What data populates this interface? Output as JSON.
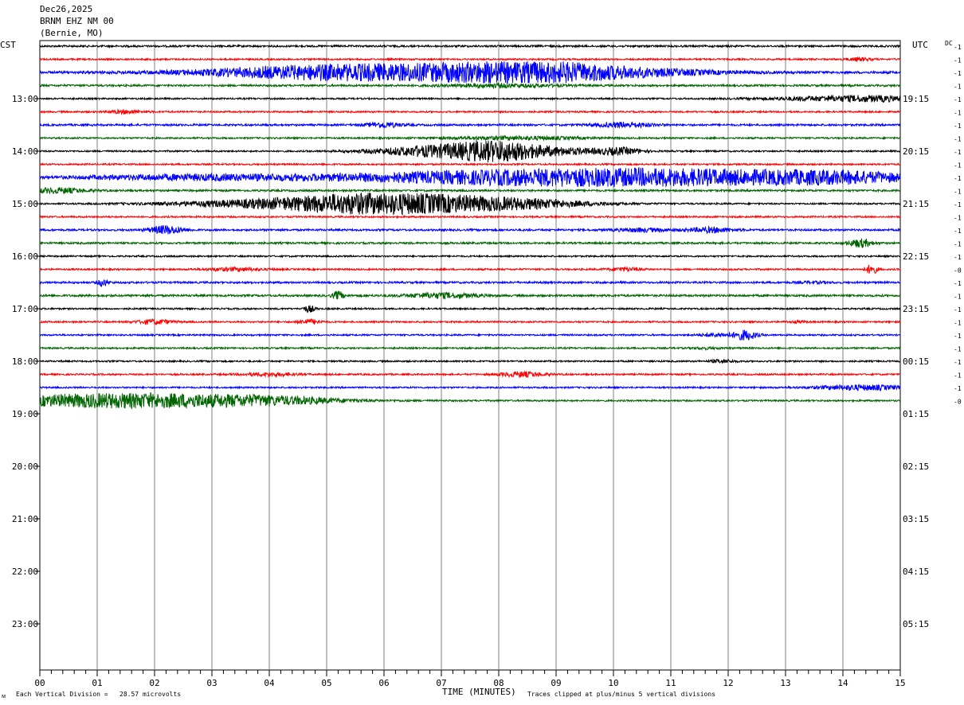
{
  "header": {
    "date": "Dec26,2025",
    "station": "BRNM EHZ NM 00",
    "location": "(Bernie, MO)"
  },
  "left_tz": "CST",
  "right_tz": "UTC",
  "dc_label": "DC",
  "footer": {
    "scale_note": "Each Vertical Division =   28.57 microvolts",
    "time_axis_label": "TIME (MINUTES)",
    "clip_note": "Traces clipped at plus/minus 5 vertical divisions",
    "corner_mark": "ᴍ"
  },
  "chart_data": {
    "type": "line",
    "title": "BRNM EHZ NM 00",
    "xlabel": "TIME (MINUTES)",
    "ylabel": "",
    "xlim": [
      0,
      15
    ],
    "x_ticks": [
      "00",
      "01",
      "02",
      "03",
      "04",
      "05",
      "06",
      "07",
      "08",
      "09",
      "10",
      "11",
      "12",
      "13",
      "14",
      "15"
    ],
    "row_minutes": 15,
    "trace_colors": [
      "#000000",
      "#ff0000",
      "#0000ff",
      "#006400"
    ],
    "left_hour_labels": [
      "13:00",
      "14:00",
      "15:00",
      "16:00",
      "17:00",
      "18:00",
      "19:00",
      "20:00",
      "21:00",
      "22:00",
      "23:00"
    ],
    "right_hour_labels": [
      "19:15",
      "20:15",
      "21:15",
      "22:15",
      "23:15",
      "00:15",
      "01:15",
      "02:15",
      "03:15",
      "04:15",
      "05:15"
    ],
    "dc_offsets": [
      "-1",
      "-1",
      "-1",
      "-1",
      "-1",
      "-1",
      "-1",
      "-1",
      "-1",
      "-1",
      "-1",
      "-1",
      "-1",
      "-1",
      "-1",
      "-1",
      "-1",
      "-0",
      "-1",
      "-1",
      "-1",
      "-1",
      "-1",
      "-1",
      "-1",
      "-1",
      "-1",
      "-0"
    ],
    "series": [
      {
        "bursts": [],
        "base": 1.2
      },
      {
        "bursts": [
          [
            14.3,
            0.2,
            2
          ]
        ],
        "base": 1.0
      },
      {
        "bursts": [
          [
            4.5,
            2.0,
            4
          ],
          [
            6.5,
            2.5,
            8
          ],
          [
            8.7,
            1.5,
            9
          ],
          [
            10.5,
            1.5,
            3
          ]
        ],
        "base": 1.5
      },
      {
        "bursts": [
          [
            8.0,
            1.0,
            2
          ]
        ],
        "base": 1.2
      },
      {
        "bursts": [
          [
            13.5,
            1.0,
            2
          ],
          [
            14.6,
            0.8,
            3
          ]
        ],
        "base": 1.0
      },
      {
        "bursts": [
          [
            1.5,
            0.3,
            2
          ]
        ],
        "base": 1.0
      },
      {
        "bursts": [
          [
            6.0,
            0.3,
            3
          ],
          [
            10.2,
            0.5,
            3
          ]
        ],
        "base": 1.2
      },
      {
        "bursts": [
          [
            8.3,
            1.2,
            2
          ]
        ],
        "base": 1.0
      },
      {
        "bursts": [
          [
            6.8,
            1.0,
            6
          ],
          [
            8.0,
            0.8,
            12
          ],
          [
            9.2,
            0.6,
            3
          ],
          [
            10.1,
            0.4,
            4
          ]
        ],
        "base": 1.0
      },
      {
        "bursts": [],
        "base": 1.0
      },
      {
        "bursts": [
          [
            2.8,
            2.0,
            3
          ],
          [
            8.0,
            3.0,
            7
          ],
          [
            11.5,
            3.0,
            8
          ],
          [
            14.0,
            1.2,
            4
          ]
        ],
        "base": 1.5
      },
      {
        "bursts": [
          [
            0.3,
            0.5,
            3
          ]
        ],
        "base": 1.2
      },
      {
        "bursts": [
          [
            3.5,
            1.5,
            3
          ],
          [
            5.5,
            1.5,
            10
          ],
          [
            7.0,
            1.5,
            7
          ],
          [
            8.5,
            1.2,
            4
          ]
        ],
        "base": 1.0
      },
      {
        "bursts": [],
        "base": 1.0
      },
      {
        "bursts": [
          [
            2.2,
            0.3,
            5
          ],
          [
            10.5,
            0.5,
            2
          ],
          [
            11.7,
            0.4,
            3
          ]
        ],
        "base": 1.2
      },
      {
        "bursts": [
          [
            14.3,
            0.2,
            5
          ]
        ],
        "base": 1.2
      },
      {
        "bursts": [],
        "base": 1.0
      },
      {
        "bursts": [
          [
            3.4,
            0.5,
            2
          ],
          [
            10.2,
            0.3,
            2
          ],
          [
            14.5,
            0.1,
            6
          ]
        ],
        "base": 1.0
      },
      {
        "bursts": [
          [
            1.1,
            0.1,
            4
          ],
          [
            13.5,
            0.3,
            1
          ]
        ],
        "base": 1.2
      },
      {
        "bursts": [
          [
            5.2,
            0.1,
            5
          ],
          [
            7.0,
            0.6,
            3
          ]
        ],
        "base": 1.3
      },
      {
        "bursts": [
          [
            4.7,
            0.1,
            4
          ]
        ],
        "base": 1.0
      },
      {
        "bursts": [
          [
            2.0,
            0.3,
            3
          ],
          [
            4.7,
            0.2,
            3
          ],
          [
            13.2,
            0.2,
            1
          ]
        ],
        "base": 1.0
      },
      {
        "bursts": [
          [
            12.3,
            0.2,
            6
          ],
          [
            11.8,
            0.3,
            2
          ]
        ],
        "base": 1.0
      },
      {
        "bursts": [
          [
            11.6,
            0.3,
            1
          ]
        ],
        "base": 1.0
      },
      {
        "bursts": [
          [
            11.9,
            0.2,
            2
          ]
        ],
        "base": 1.0
      },
      {
        "bursts": [
          [
            4.0,
            0.5,
            2
          ],
          [
            8.4,
            0.4,
            3
          ]
        ],
        "base": 1.0
      },
      {
        "bursts": [
          [
            14.3,
            0.8,
            3
          ]
        ],
        "base": 1.0
      },
      {
        "bursts": [
          [
            1.5,
            2.5,
            9
          ],
          [
            4.0,
            1.2,
            3
          ]
        ],
        "base": 1.0
      }
    ]
  }
}
